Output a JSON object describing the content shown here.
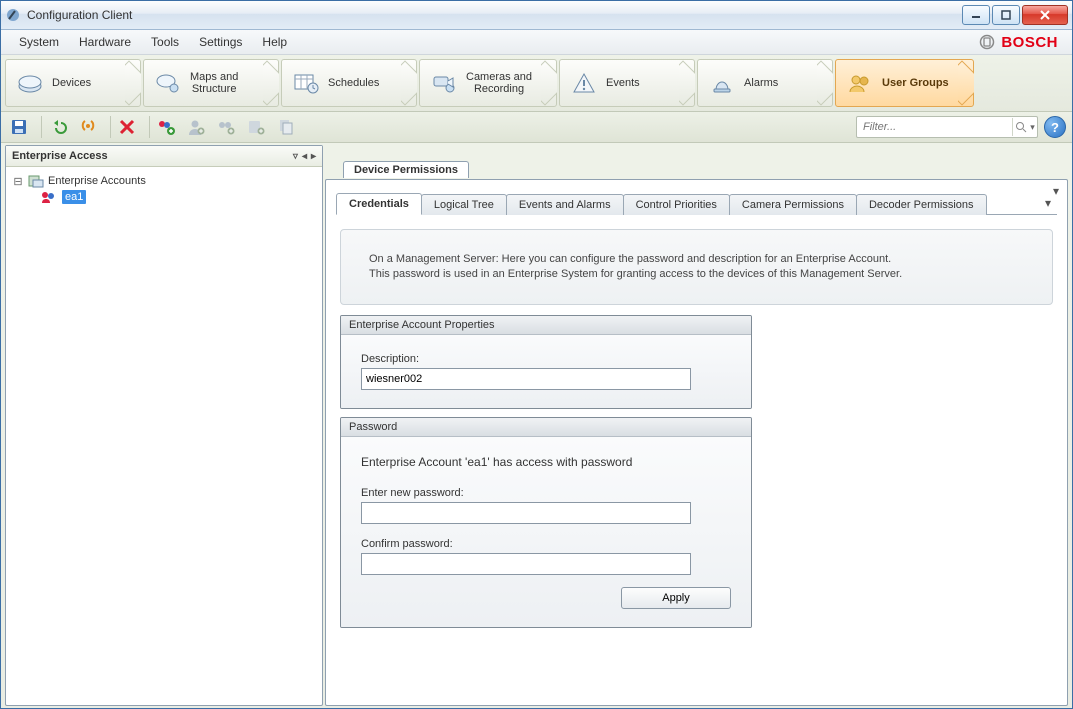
{
  "window": {
    "title": "Configuration Client"
  },
  "menu": {
    "system": "System",
    "hardware": "Hardware",
    "tools": "Tools",
    "settings": "Settings",
    "help": "Help"
  },
  "brand": {
    "name": "BOSCH"
  },
  "workflow": {
    "devices": "Devices",
    "maps": "Maps and\nStructure",
    "schedules": "Schedules",
    "cameras": "Cameras and\nRecording",
    "events": "Events",
    "alarms": "Alarms",
    "usergroups": "User Groups"
  },
  "filter": {
    "placeholder": "Filter..."
  },
  "sidebar": {
    "title": "Enterprise Access",
    "root": "Enterprise Accounts",
    "items": [
      {
        "label": "ea1"
      }
    ]
  },
  "panel": {
    "title": "Device Permissions",
    "tabs": {
      "credentials": "Credentials",
      "logicaltree": "Logical Tree",
      "eventsalarms": "Events and Alarms",
      "controlpriorities": "Control Priorities",
      "cameraperms": "Camera Permissions",
      "decoderperms": "Decoder Permissions"
    },
    "hint_line1": "On a Management Server: Here you can configure the password and description for an Enterprise Account.",
    "hint_line2": "This password is used in an Enterprise System for granting access to the devices of this Management Server.",
    "group_props": {
      "title": "Enterprise Account Properties",
      "description_label": "Description:",
      "description_value": "wiesner002"
    },
    "group_pw": {
      "title": "Password",
      "status": "Enterprise Account 'ea1' has access with password",
      "new_label": "Enter new password:",
      "confirm_label": "Confirm password:",
      "apply": "Apply"
    }
  }
}
